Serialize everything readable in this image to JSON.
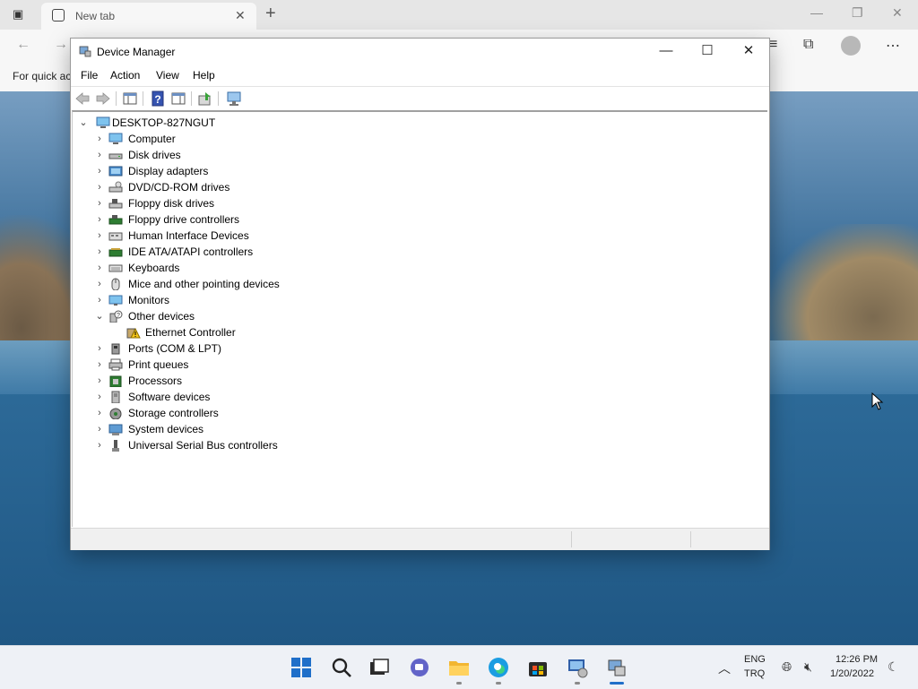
{
  "browser": {
    "tab_title": "New tab",
    "favorites_text": "For quick ac"
  },
  "window": {
    "title": "Device Manager",
    "menu": [
      "File",
      "Action",
      "View",
      "Help"
    ]
  },
  "tree": {
    "root": "DESKTOP-827NGUT",
    "items": [
      {
        "label": "Computer",
        "icon": "computer-icon",
        "expanded": false
      },
      {
        "label": "Disk drives",
        "icon": "disk-drive-icon",
        "expanded": false
      },
      {
        "label": "Display adapters",
        "icon": "display-adapter-icon",
        "expanded": false
      },
      {
        "label": "DVD/CD-ROM drives",
        "icon": "dvd-drive-icon",
        "expanded": false
      },
      {
        "label": "Floppy disk drives",
        "icon": "floppy-drive-icon",
        "expanded": false
      },
      {
        "label": "Floppy drive controllers",
        "icon": "floppy-controller-icon",
        "expanded": false
      },
      {
        "label": "Human Interface Devices",
        "icon": "hid-icon",
        "expanded": false
      },
      {
        "label": "IDE ATA/ATAPI controllers",
        "icon": "ide-controller-icon",
        "expanded": false
      },
      {
        "label": "Keyboards",
        "icon": "keyboard-icon",
        "expanded": false
      },
      {
        "label": "Mice and other pointing devices",
        "icon": "mouse-icon",
        "expanded": false
      },
      {
        "label": "Monitors",
        "icon": "monitor-icon",
        "expanded": false
      },
      {
        "label": "Other devices",
        "icon": "unknown-device-icon",
        "expanded": true
      },
      {
        "label": "Ethernet Controller",
        "icon": "warning-device-icon",
        "child": true
      },
      {
        "label": "Ports (COM & LPT)",
        "icon": "port-icon",
        "expanded": false
      },
      {
        "label": "Print queues",
        "icon": "printer-icon",
        "expanded": false
      },
      {
        "label": "Processors",
        "icon": "processor-icon",
        "expanded": false
      },
      {
        "label": "Software devices",
        "icon": "software-device-icon",
        "expanded": false
      },
      {
        "label": "Storage controllers",
        "icon": "storage-controller-icon",
        "expanded": false
      },
      {
        "label": "System devices",
        "icon": "system-device-icon",
        "expanded": false
      },
      {
        "label": "Universal Serial Bus controllers",
        "icon": "usb-icon",
        "expanded": false
      }
    ]
  },
  "taskbar": {
    "lang_top": "ENG",
    "lang_bottom": "TRQ",
    "time": "12:26 PM",
    "date": "1/20/2022"
  }
}
